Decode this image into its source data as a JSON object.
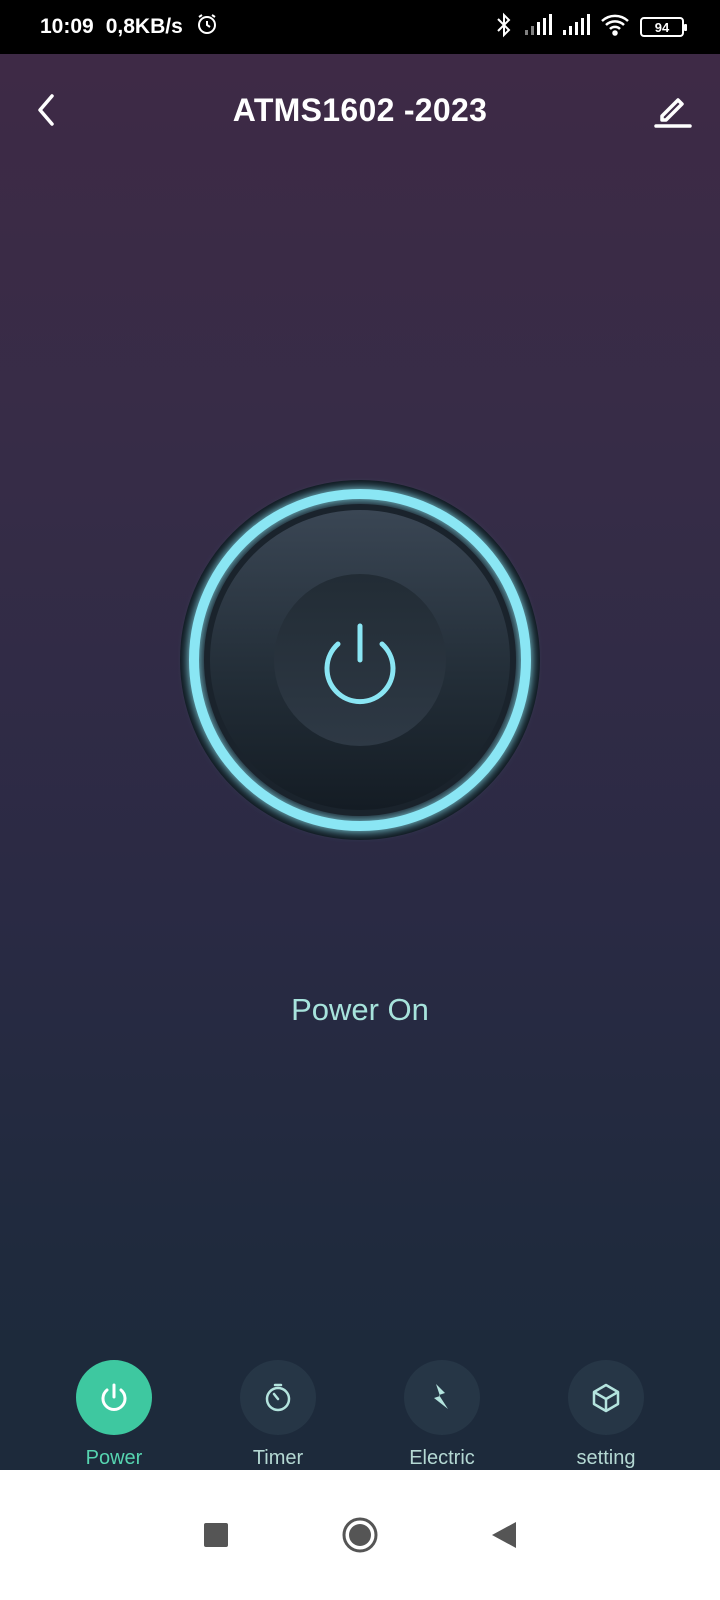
{
  "status_bar": {
    "time": "10:09",
    "network_speed": "0,8KB/s",
    "battery": "94",
    "icons": [
      "alarm-icon",
      "bluetooth-icon",
      "signal-icon",
      "signal-icon",
      "wifi-icon",
      "battery-icon"
    ]
  },
  "header": {
    "title": "ATMS1602 -2023",
    "back_icon": "chevron-left-icon",
    "edit_icon": "pencil-icon"
  },
  "main": {
    "power_icon": "power-icon",
    "power_status": "Power On"
  },
  "bottom_nav": {
    "items": [
      {
        "label": "Power",
        "icon": "power-icon",
        "active": true
      },
      {
        "label": "Timer",
        "icon": "timer-icon",
        "active": false
      },
      {
        "label": "Electric",
        "icon": "lightning-icon",
        "active": false
      },
      {
        "label": "setting",
        "icon": "cube-icon",
        "active": false
      }
    ]
  },
  "system_nav": {
    "icons": [
      "recents-icon",
      "home-icon",
      "back-icon"
    ]
  },
  "colors": {
    "accent": "#3ec8a0",
    "glow": "#8ae6f4",
    "status_text": "#a7e3dc"
  }
}
